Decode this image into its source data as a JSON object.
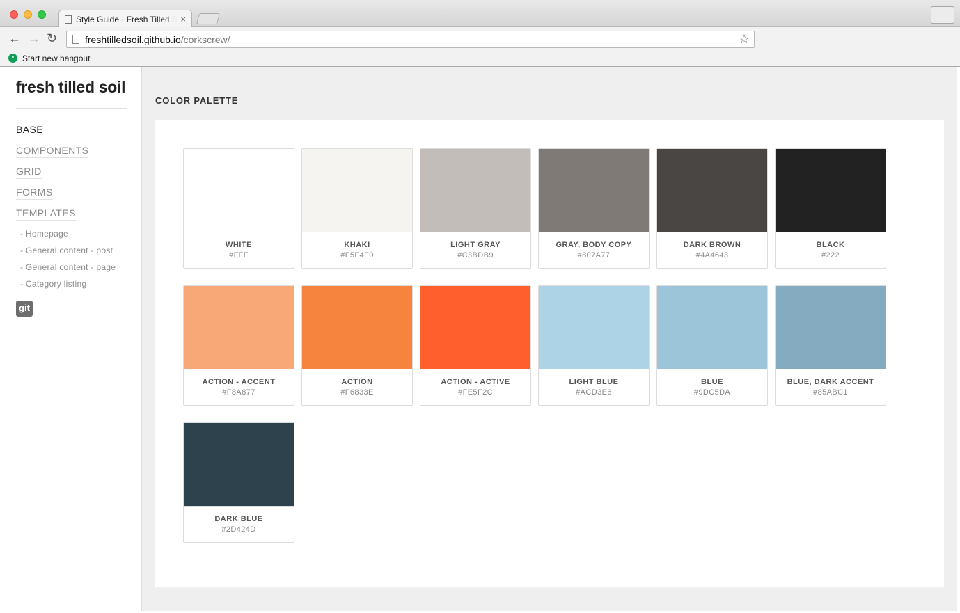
{
  "browser": {
    "tab_title": "Style Guide · Fresh Tilled Soil",
    "tab_close": "×",
    "url_host": "freshtilledsoil.github.io",
    "url_path": "/corkscrew/",
    "bookmark_label": "Start new hangout",
    "icons": {
      "back": "arrow-left-icon",
      "forward": "arrow-right-icon",
      "reload": "reload-icon",
      "star": "star-icon"
    }
  },
  "sidebar": {
    "logo": "fresh tilled soil",
    "nav": [
      {
        "label": "BASE"
      },
      {
        "label": "COMPONENTS"
      },
      {
        "label": "GRID"
      },
      {
        "label": "FORMS"
      },
      {
        "label": "TEMPLATES"
      }
    ],
    "subnav": [
      {
        "label": "- Homepage"
      },
      {
        "label": "- General content - post"
      },
      {
        "label": "- General content - page"
      },
      {
        "label": "- Category listing"
      }
    ],
    "git_label": "git"
  },
  "main": {
    "section_title": "COLOR PALETTE",
    "swatches": [
      {
        "name": "WHITE",
        "hex": "#FFF",
        "color": "#FFFFFF"
      },
      {
        "name": "KHAKI",
        "hex": "#F5F4F0",
        "color": "#F5F4F0"
      },
      {
        "name": "LIGHT GRAY",
        "hex": "#C3BDB9",
        "color": "#C3BDB9"
      },
      {
        "name": "GRAY, BODY COPY",
        "hex": "#807A77",
        "color": "#807A77"
      },
      {
        "name": "DARK BROWN",
        "hex": "#4A4643",
        "color": "#4A4643"
      },
      {
        "name": "BLACK",
        "hex": "#222",
        "color": "#222222"
      },
      {
        "name": "ACTION - ACCENT",
        "hex": "#F8A877",
        "color": "#F8A877"
      },
      {
        "name": "ACTION",
        "hex": "#F6833E",
        "color": "#F6833E"
      },
      {
        "name": "ACTION - ACTIVE",
        "hex": "#FE5F2C",
        "color": "#FE5F2C"
      },
      {
        "name": "LIGHT BLUE",
        "hex": "#ACD3E6",
        "color": "#ACD3E6"
      },
      {
        "name": "BLUE",
        "hex": "#9DC5DA",
        "color": "#9DC5DA"
      },
      {
        "name": "BLUE, DARK ACCENT",
        "hex": "#85ABC1",
        "color": "#85ABC1"
      },
      {
        "name": "DARK BLUE",
        "hex": "#2D424D",
        "color": "#2D424D"
      }
    ]
  }
}
